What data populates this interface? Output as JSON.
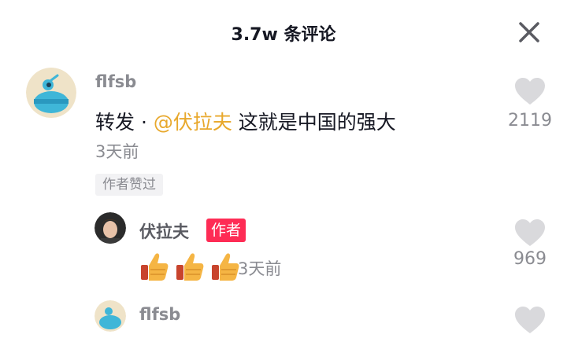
{
  "header": {
    "title": "3.7w 条评论",
    "close_icon": "close-icon"
  },
  "comments": [
    {
      "username": "flfsb",
      "text_prefix": "转发 · ",
      "mention": "@伏拉夫",
      "text_suffix": " 这就是中国的强大",
      "time": "3天前",
      "badge": "作者赞过",
      "likes": "2119"
    },
    {
      "username": "伏拉夫",
      "author_badge": "作者",
      "emoji": [
        "thumbs-up",
        "thumbs-up",
        "thumbs-up"
      ],
      "time": "3天前",
      "likes": "969"
    },
    {
      "username": "flfsb"
    }
  ],
  "colors": {
    "mention": "#e8a82c",
    "author_badge": "#fe2c55",
    "muted": "#8a8b91",
    "heart": "#d9d9dc"
  }
}
